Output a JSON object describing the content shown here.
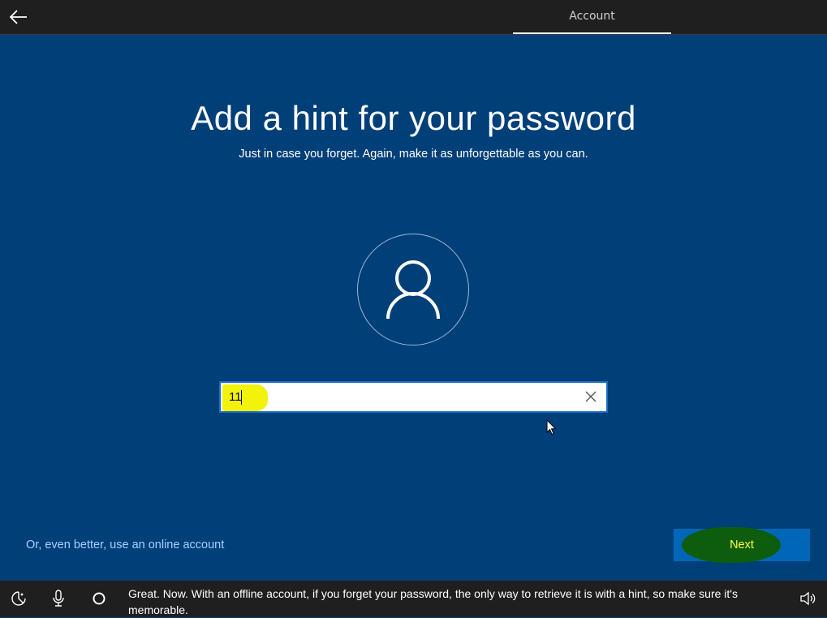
{
  "header": {
    "tab_label": "Account"
  },
  "main": {
    "title": "Add a hint for your password",
    "subtitle": "Just in case you forget. Again, make it as unforgettable as you can.",
    "hint_input": {
      "value": "11",
      "placeholder": ""
    },
    "online_account_link": "Or, even better, use an online account",
    "next_label": "Next"
  },
  "footer": {
    "narration": "Great. Now. With an offline account, if you forget your password, the only way to retrieve it is with a hint, so make sure it's memorable."
  },
  "icons": {
    "back": "back-arrow-icon",
    "avatar": "user-icon",
    "clear": "close-icon",
    "ease_of_access": "ease-of-access-icon",
    "microphone": "microphone-icon",
    "cortana": "cortana-icon",
    "volume": "volume-icon"
  },
  "colors": {
    "background": "#003f78",
    "top_bar": "#1f1f1f",
    "accent": "#0067b8",
    "link": "#a6d1ff",
    "highlight_yellow": "#f2f20b",
    "highlight_green": "#0e5d0e"
  }
}
